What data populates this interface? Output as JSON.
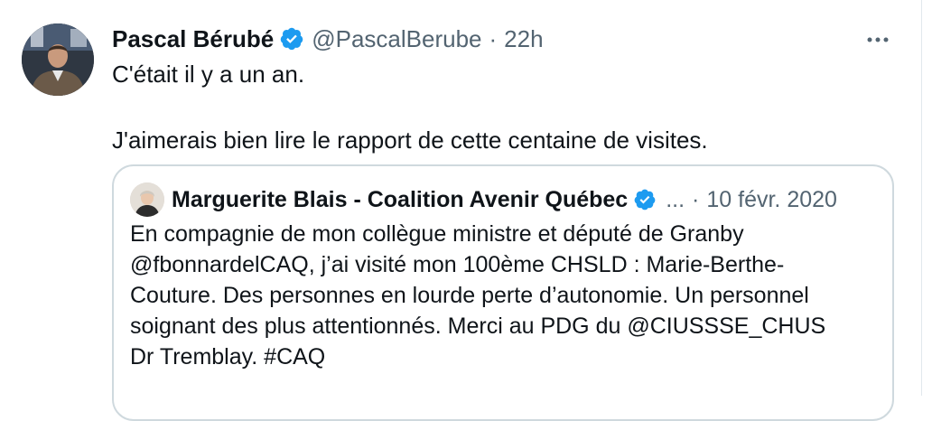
{
  "tweet": {
    "author_name": "Pascal Bérubé",
    "author_handle": "@PascalBerube",
    "separator": "·",
    "time": "22h",
    "more_label": "···",
    "text_line1": "C'était il y a un an.",
    "text_line2": "J'aimerais bien lire le rapport de cette centaine de visites."
  },
  "quote": {
    "author_name": "Marguerite Blais - Coalition Avenir Québec",
    "ellipsis": "...",
    "separator": "·",
    "date": "10 févr. 2020",
    "lines": [
      "En compagnie de mon collègue ministre et député de Granby",
      "@fbonnardelCAQ, j’ai visité mon 100ème CHSLD : Marie-Berthe-",
      "Couture. Des personnes en lourde perte d’autonomie. Un personnel",
      "soignant des plus attentionnés. Merci au PDG du @CIUSSSE_CHUS",
      "Dr Tremblay. #CAQ"
    ]
  },
  "colors": {
    "text": "#0f1419",
    "secondary": "#536471",
    "verified": "#1d9bf0",
    "border": "#cfd9de"
  },
  "icons": {
    "verified": "verified-badge-icon",
    "more": "more-horizontal-icon"
  }
}
